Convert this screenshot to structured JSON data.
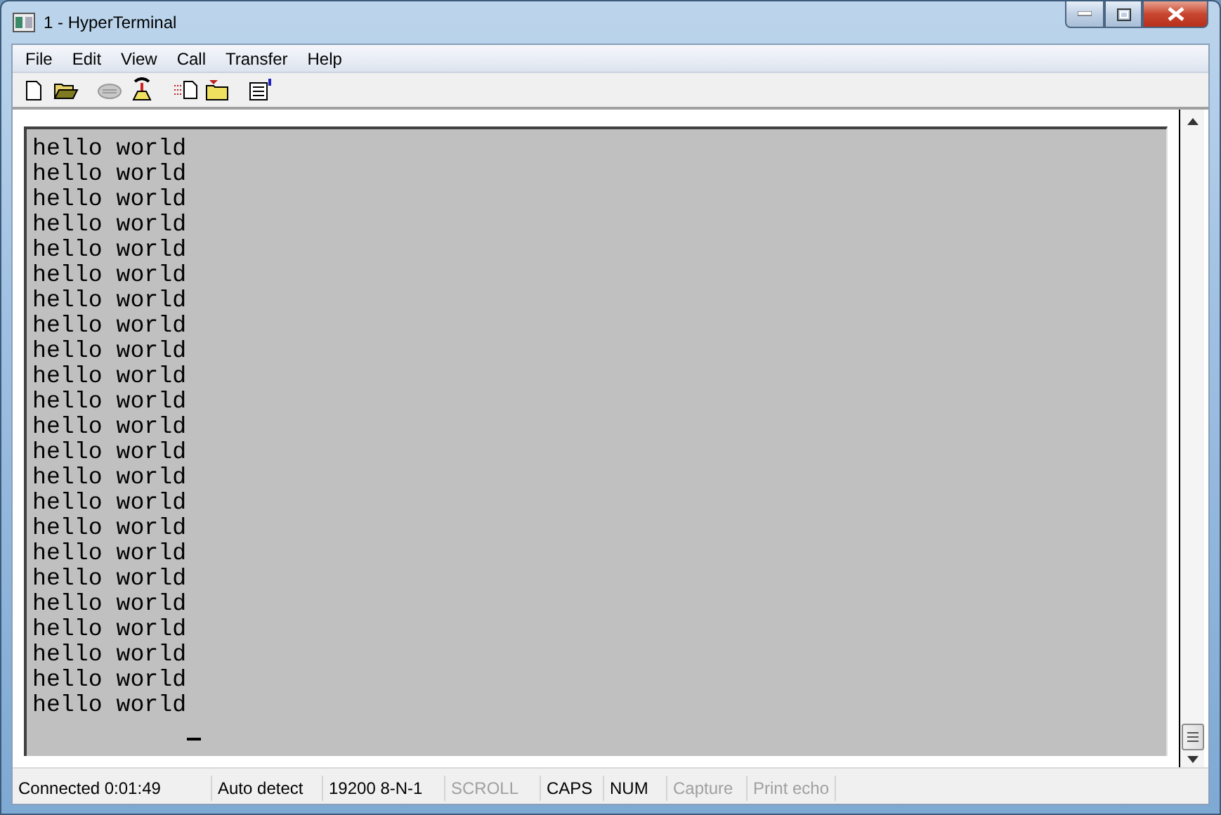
{
  "window": {
    "title": "1 - HyperTerminal"
  },
  "menu": [
    "File",
    "Edit",
    "View",
    "Call",
    "Transfer",
    "Help"
  ],
  "toolbar": [
    {
      "kind": "new",
      "disabled": false
    },
    {
      "kind": "open",
      "disabled": false
    },
    {
      "kind": "gap"
    },
    {
      "kind": "call",
      "disabled": true
    },
    {
      "kind": "disconnect",
      "disabled": false
    },
    {
      "kind": "gap"
    },
    {
      "kind": "send",
      "disabled": false
    },
    {
      "kind": "receive",
      "disabled": false
    },
    {
      "kind": "gap"
    },
    {
      "kind": "properties",
      "disabled": false
    }
  ],
  "terminal": {
    "lines": [
      "hello world",
      "hello world",
      "hello world",
      "hello world",
      "hello world",
      "hello world",
      "hello world",
      "hello world",
      "hello world",
      "hello world",
      "hello world",
      "hello world",
      "hello world",
      "hello world",
      "hello world",
      "hello world",
      "hello world",
      "hello world",
      "hello world",
      "hello world",
      "hello world",
      "hello world",
      "hello world"
    ]
  },
  "status_bar": [
    {
      "text": "Connected 0:01:49",
      "disabled": false
    },
    {
      "text": "Auto detect",
      "disabled": false
    },
    {
      "text": "19200 8-N-1",
      "disabled": false
    },
    {
      "text": "SCROLL",
      "disabled": true
    },
    {
      "text": "CAPS",
      "disabled": false
    },
    {
      "text": "NUM",
      "disabled": false
    },
    {
      "text": "Capture",
      "disabled": true
    },
    {
      "text": "Print echo",
      "disabled": true
    }
  ]
}
